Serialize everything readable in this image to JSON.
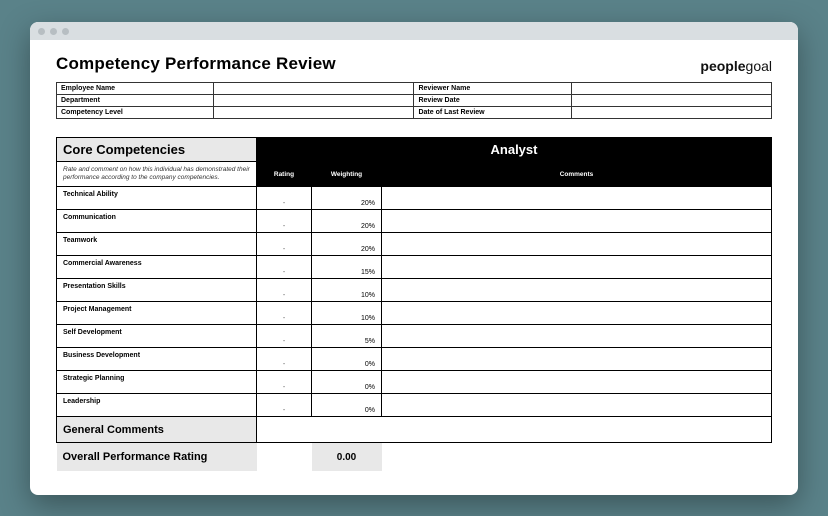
{
  "title": "Competency Performance Review",
  "brand_prefix": "people",
  "brand_suffix": "goal",
  "meta": {
    "employee_name_label": "Employee Name",
    "employee_name": "",
    "reviewer_name_label": "Reviewer Name",
    "reviewer_name": "",
    "department_label": "Department",
    "department": "",
    "review_date_label": "Review Date",
    "review_date": "",
    "competency_level_label": "Competency Level",
    "competency_level": "",
    "last_review_label": "Date of Last Review",
    "last_review": ""
  },
  "core_heading": "Core Competencies",
  "role_heading": "Analyst",
  "instructions": "Rate and comment on how this individual has demonstrated their performance according to the company competencies.",
  "col_rating": "Rating",
  "col_weighting": "Weighting",
  "col_comments": "Comments",
  "rating_placeholder": "-",
  "rows": [
    {
      "label": "Technical Ability",
      "weight": "20%"
    },
    {
      "label": "Communication",
      "weight": "20%"
    },
    {
      "label": "Teamwork",
      "weight": "20%"
    },
    {
      "label": "Commercial Awareness",
      "weight": "15%"
    },
    {
      "label": "Presentation Skills",
      "weight": "10%"
    },
    {
      "label": "Project Management",
      "weight": "10%"
    },
    {
      "label": "Self Development",
      "weight": "5%"
    },
    {
      "label": "Business Development",
      "weight": "0%"
    },
    {
      "label": "Strategic Planning",
      "weight": "0%"
    },
    {
      "label": "Leadership",
      "weight": "0%"
    }
  ],
  "general_comments_label": "General Comments",
  "overall_label": "Overall Performance Rating",
  "overall_value": "0.00"
}
